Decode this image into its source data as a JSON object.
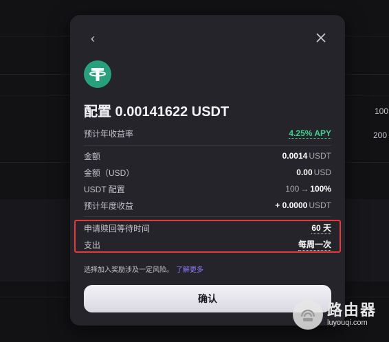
{
  "background": {
    "right_values": [
      "100",
      "200"
    ]
  },
  "modal": {
    "back_icon": "‹",
    "close_icon": "✕",
    "coin_icon": "tether-usdt-icon",
    "title": "配置 0.00141622 USDT",
    "apy_row": {
      "label": "预计年收益率",
      "value": "4.25% APY"
    },
    "amount_row": {
      "label": "金额",
      "value": "0.0014",
      "unit": "USDT"
    },
    "amount_usd_row": {
      "label": "金额（USD）",
      "value": "0.00",
      "unit": "USD"
    },
    "allocation_row": {
      "label": "USDT 配置",
      "from": "100",
      "arrow": "→",
      "to": "100%"
    },
    "annual_earn_row": {
      "label": "预计年度收益",
      "value": "+ 0.0000",
      "unit": "USDT"
    },
    "redeem_row": {
      "label": "申请赎回等待时间",
      "value": "60 天"
    },
    "payout_row": {
      "label": "支出",
      "value": "每周一次"
    },
    "note": "选择加入奖励涉及一定风险。",
    "learn_more": "了解更多",
    "confirm_label": "确认"
  },
  "watermark": {
    "cn": "路由器",
    "en": "luyouqi.com"
  },
  "colors": {
    "accent_green": "#3fd18d",
    "link_purple": "#8f7cff",
    "highlight_red": "#e8393a",
    "tether_green": "#26a17b"
  }
}
